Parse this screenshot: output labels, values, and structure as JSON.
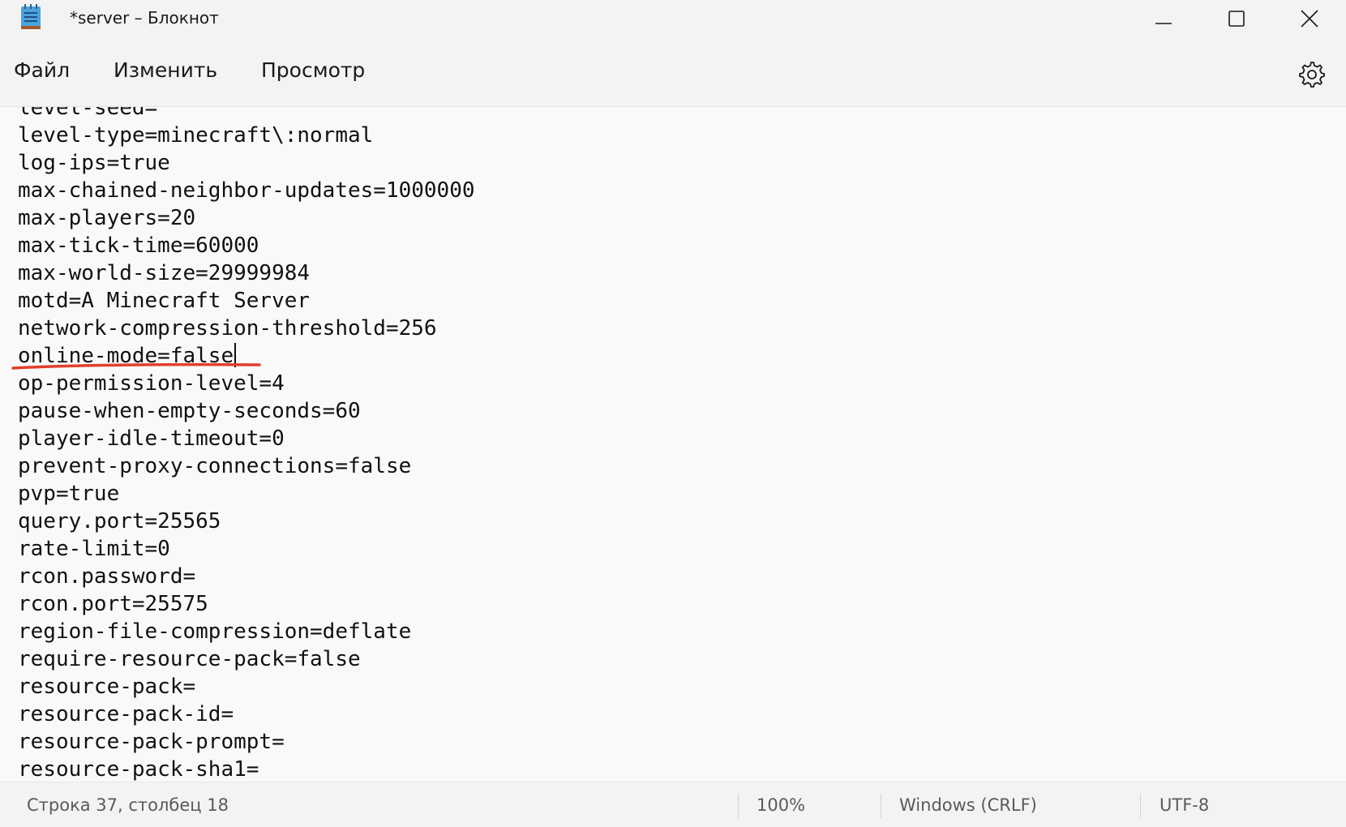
{
  "window": {
    "title": "*server – Блокнот",
    "minimize_icon": "minimize-icon",
    "maximize_icon": "maximize-icon",
    "close_icon": "close-icon"
  },
  "menu": {
    "file": "Файл",
    "edit": "Изменить",
    "view": "Просмотр",
    "settings_icon": "gear-icon"
  },
  "editor": {
    "lines": [
      "level-seed=",
      "level-type=minecraft\\:normal",
      "log-ips=true",
      "max-chained-neighbor-updates=1000000",
      "max-players=20",
      "max-tick-time=60000",
      "max-world-size=29999984",
      "motd=A Minecraft Server",
      "network-compression-threshold=256",
      "online-mode=false",
      "op-permission-level=4",
      "pause-when-empty-seconds=60",
      "player-idle-timeout=0",
      "prevent-proxy-connections=false",
      "pvp=true",
      "query.port=25565",
      "rate-limit=0",
      "rcon.password=",
      "rcon.port=25575",
      "region-file-compression=deflate",
      "require-resource-pack=false",
      "resource-pack=",
      "resource-pack-id=",
      "resource-pack-prompt=",
      "resource-pack-sha1="
    ],
    "caret_line": 9,
    "highlight_line": 9,
    "highlight_color": "#e0402a"
  },
  "status": {
    "position": "Строка 37, столбец 18",
    "zoom": "100%",
    "line_ending": "Windows (CRLF)",
    "encoding": "UTF-8"
  }
}
